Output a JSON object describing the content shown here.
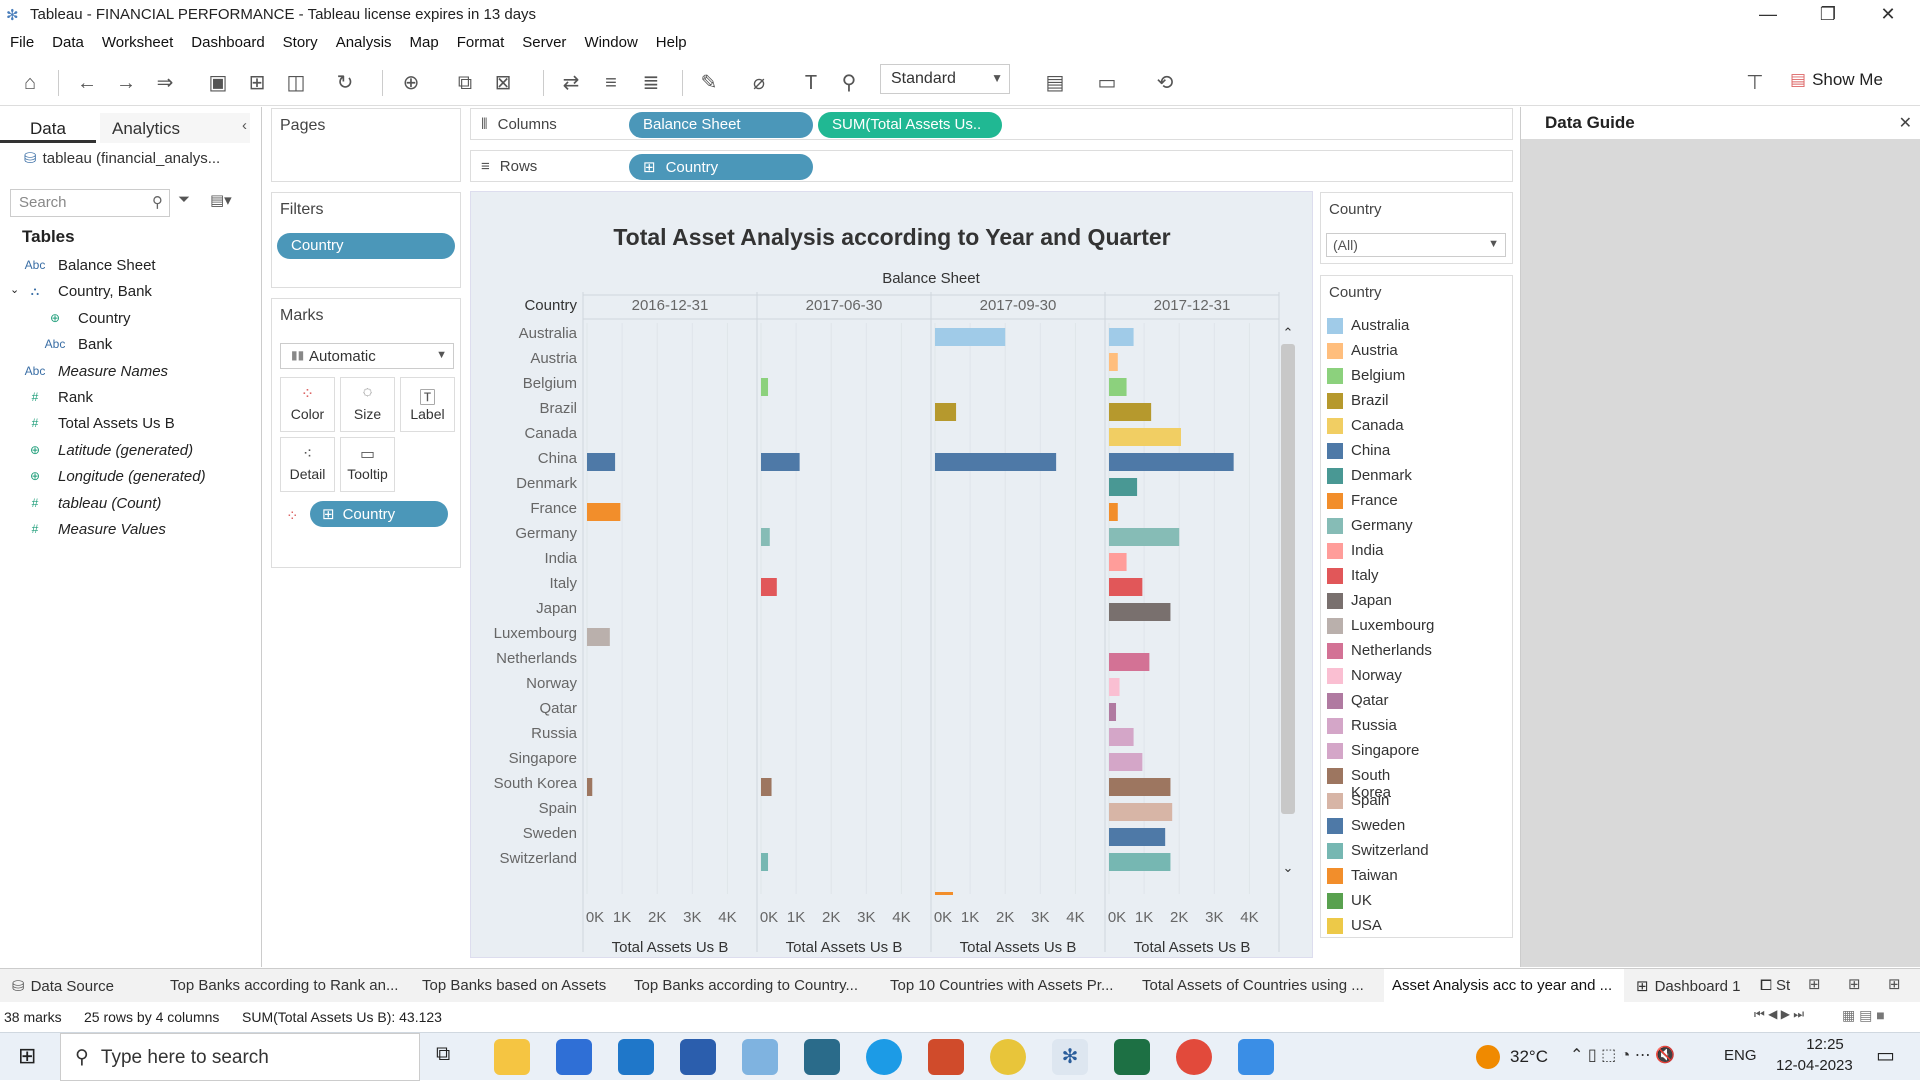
{
  "window": {
    "title": "Tableau - FINANCIAL PERFORMANCE - Tableau license expires in 13 days"
  },
  "menu": [
    "File",
    "Data",
    "Worksheet",
    "Dashboard",
    "Story",
    "Analysis",
    "Map",
    "Format",
    "Server",
    "Window",
    "Help"
  ],
  "toolbar": {
    "fit": "Standard",
    "show_me": "Show Me"
  },
  "left_panel": {
    "tab_data": "Data",
    "tab_analytics": "Analytics",
    "datasource": "tableau (financial_analys...",
    "search_placeholder": "Search",
    "tables_heading": "Tables",
    "fields": [
      {
        "icon": "Abc",
        "label": "Balance Sheet",
        "italic": false,
        "indent": 0
      },
      {
        "icon": "hier",
        "label": "Country, Bank",
        "italic": false,
        "indent": 0
      },
      {
        "icon": "globe",
        "label": "Country",
        "italic": false,
        "indent": 1
      },
      {
        "icon": "Abc",
        "label": "Bank",
        "italic": false,
        "indent": 1
      },
      {
        "icon": "Abc",
        "label": "Measure Names",
        "italic": true,
        "indent": 0
      },
      {
        "icon": "#",
        "label": "Rank",
        "italic": false,
        "indent": 0
      },
      {
        "icon": "#",
        "label": "Total Assets Us B",
        "italic": false,
        "indent": 0
      },
      {
        "icon": "globe",
        "label": "Latitude (generated)",
        "italic": true,
        "indent": 0
      },
      {
        "icon": "globe",
        "label": "Longitude (generated)",
        "italic": true,
        "indent": 0
      },
      {
        "icon": "#",
        "label": "tableau (Count)",
        "italic": true,
        "indent": 0
      },
      {
        "icon": "#",
        "label": "Measure Values",
        "italic": true,
        "indent": 0
      }
    ]
  },
  "cards": {
    "pages": "Pages",
    "filters": "Filters",
    "filter_pill": "Country",
    "marks": "Marks",
    "mark_type": "Automatic",
    "mark_buttons": [
      "Color",
      "Size",
      "Label",
      "Detail",
      "Tooltip"
    ],
    "marks_pill": "Country"
  },
  "shelves": {
    "columns_label": "Columns",
    "rows_label": "Rows",
    "col_pill1": "Balance Sheet",
    "col_pill2": "SUM(Total Assets Us..",
    "row_pill": "Country"
  },
  "filter_card": {
    "title": "Country",
    "value": "(All)"
  },
  "legend": {
    "title": "Country"
  },
  "right_panel": {
    "title": "Data Guide"
  },
  "tabs": [
    "Data Source",
    "Top Banks according to Rank an...",
    "Top Banks based on Assets",
    "Top Banks according to Country...",
    "Top 10 Countries with Assets Pr...",
    "Total Assets of Countries using ...",
    "Asset Analysis acc to year and ...",
    "Dashboard 1",
    "St"
  ],
  "status": {
    "marks": "38 marks",
    "dims": "25 rows by 4 columns",
    "sum": "SUM(Total Assets Us B): 43.123"
  },
  "taskbar": {
    "search": "Type here to search",
    "temp": "32°C",
    "lang": "ENG",
    "time": "12:25",
    "date": "12-04-2023"
  },
  "colors": {
    "Australia": "#a0cbe8",
    "Austria": "#ffbe7d",
    "Belgium": "#8cd17d",
    "Brazil": "#b6992d",
    "Canada": "#f1ce63",
    "China": "#4e79a7",
    "Denmark": "#499894",
    "France": "#f28e2b",
    "Germany": "#86bcb6",
    "India": "#ff9d9a",
    "Italy": "#e15759",
    "Japan": "#79706e",
    "Luxembourg": "#bab0ac",
    "Netherlands": "#d37295",
    "Norway": "#fabfd2",
    "Qatar": "#b07aa1",
    "Russia": "#d4a6c8",
    "Singapore": "#d4a6c8",
    "South Korea": "#9d7660",
    "Spain": "#d7b5a6",
    "Sweden": "#4e79a7",
    "Switzerland": "#76b7b2",
    "Taiwan": "#f28e2b",
    "UK": "#59a14f",
    "USA": "#edc948"
  },
  "chart_data": {
    "type": "bar",
    "title": "Total Asset Analysis according to Year and Quarter",
    "column_header": "Balance Sheet",
    "row_header": "Country",
    "xlabel": "Total Assets Us B",
    "xlim": [
      0,
      4.5
    ],
    "xticks": [
      "0K",
      "1K",
      "2K",
      "3K",
      "4K"
    ],
    "panels": [
      "2016-12-31",
      "2017-06-30",
      "2017-09-30",
      "2017-12-31"
    ],
    "categories": [
      "Australia",
      "Austria",
      "Belgium",
      "Brazil",
      "Canada",
      "China",
      "Denmark",
      "France",
      "Germany",
      "India",
      "Italy",
      "Japan",
      "Luxembourg",
      "Netherlands",
      "Norway",
      "Qatar",
      "Russia",
      "Singapore",
      "South Korea",
      "Spain",
      "Sweden",
      "Switzerland"
    ],
    "legend_items": [
      "Australia",
      "Austria",
      "Belgium",
      "Brazil",
      "Canada",
      "China",
      "Denmark",
      "France",
      "Germany",
      "India",
      "Italy",
      "Japan",
      "Luxembourg",
      "Netherlands",
      "Norway",
      "Qatar",
      "Russia",
      "Singapore",
      "South Korea",
      "Spain",
      "Sweden",
      "Switzerland",
      "Taiwan",
      "UK",
      "USA"
    ],
    "series": [
      {
        "name": "2016-12-31",
        "values": [
          0,
          0,
          0,
          0,
          0,
          0.8,
          0,
          0.95,
          0,
          0,
          0,
          0,
          0.65,
          0,
          0,
          0,
          0,
          0,
          0.15,
          0,
          0,
          0
        ]
      },
      {
        "name": "2017-06-30",
        "values": [
          0,
          0,
          0.2,
          0,
          0,
          1.1,
          0,
          0,
          0.25,
          0,
          0.45,
          0,
          0,
          0,
          0,
          0,
          0,
          0,
          0.3,
          0,
          0,
          0.2
        ]
      },
      {
        "name": "2017-09-30",
        "values": [
          2.0,
          0,
          0,
          0.6,
          0,
          3.45,
          0,
          0,
          0,
          0,
          0,
          0,
          0,
          0,
          0,
          0,
          0,
          0,
          0,
          0,
          0,
          0
        ]
      },
      {
        "name": "2017-12-31",
        "values": [
          0.7,
          0.25,
          0.5,
          1.2,
          2.05,
          3.55,
          0.8,
          0.25,
          2.0,
          0.5,
          0.95,
          1.75,
          0,
          1.15,
          0.3,
          0.2,
          0.7,
          0.95,
          1.75,
          1.8,
          1.6,
          1.75
        ]
      }
    ]
  }
}
